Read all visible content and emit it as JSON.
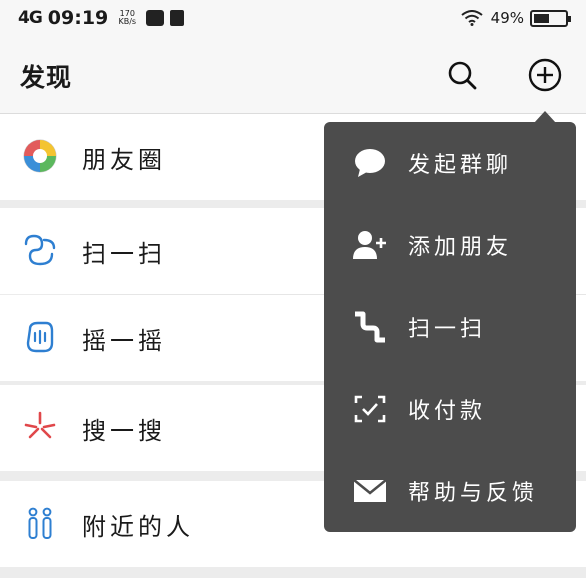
{
  "status_bar": {
    "signal": "4G",
    "time": "09:19",
    "speed": "170 KB/s",
    "battery_text": "49%",
    "battery_level": 0.49
  },
  "header": {
    "title": "发现",
    "search_icon": "search-icon",
    "add_icon": "plus-circle-icon"
  },
  "list": {
    "items": [
      {
        "label": "朋友圈",
        "icon": "moments-icon"
      },
      {
        "label": "扫一扫",
        "icon": "scan-icon"
      },
      {
        "label": "摇一摇",
        "icon": "shake-icon"
      },
      {
        "label": "搜一搜",
        "icon": "search-search-icon"
      },
      {
        "label": "附近的人",
        "icon": "nearby-people-icon"
      }
    ]
  },
  "menu": {
    "items": [
      {
        "label": "发起群聊",
        "icon": "chat-bubble-icon"
      },
      {
        "label": "添加朋友",
        "icon": "add-friend-icon"
      },
      {
        "label": "扫一扫",
        "icon": "scan-icon"
      },
      {
        "label": "收付款",
        "icon": "payment-icon"
      },
      {
        "label": "帮助与反馈",
        "icon": "mail-icon"
      }
    ]
  },
  "colors": {
    "menu_bg": "#4c4c4c",
    "page_bg": "#ececec",
    "row_bg": "#ffffff",
    "scan_blue": "#2e7fd1",
    "search_red": "#e0474a"
  }
}
